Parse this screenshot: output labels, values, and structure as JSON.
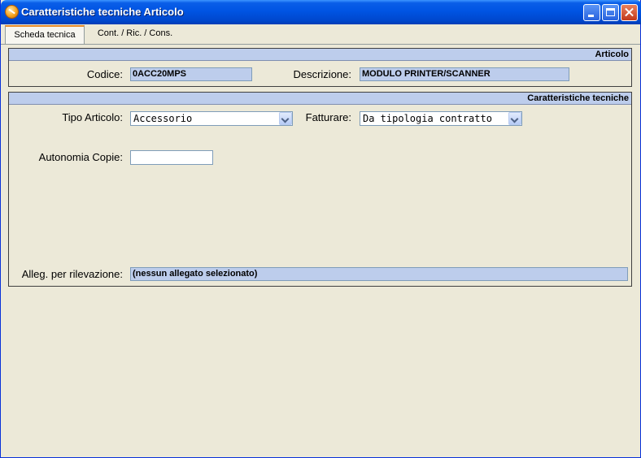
{
  "window": {
    "title": "Caratteristiche tecniche Articolo",
    "icon": "app-icon",
    "controls": [
      "minimize-icon",
      "maximize-icon",
      "close-icon"
    ]
  },
  "tabs": [
    {
      "label": "Scheda tecnica",
      "active": true
    },
    {
      "label": "Cont. / Ric. / Cons.",
      "active": false
    }
  ],
  "articolo": {
    "header": "Articolo",
    "codice_label": "Codice:",
    "codice_value": "0ACC20MPS",
    "descrizione_label": "Descrizione:",
    "descrizione_value": "MODULO PRINTER/SCANNER"
  },
  "caratteristiche": {
    "header": "Caratteristiche tecniche",
    "tipo_label": "Tipo Articolo:",
    "tipo_value": "Accessorio",
    "fatturare_label": "Fatturare:",
    "fatturare_value": "Da tipologia contratto",
    "autonomia_label": "Autonomia Copie:",
    "autonomia_value": "",
    "alleg_label": "Alleg. per rilevazione:",
    "alleg_value": "(nessun allegato selezionato)"
  },
  "colors": {
    "titlebar": "#0054e3",
    "panel_header": "#bdcdec",
    "window_bg": "#ece9d8"
  }
}
